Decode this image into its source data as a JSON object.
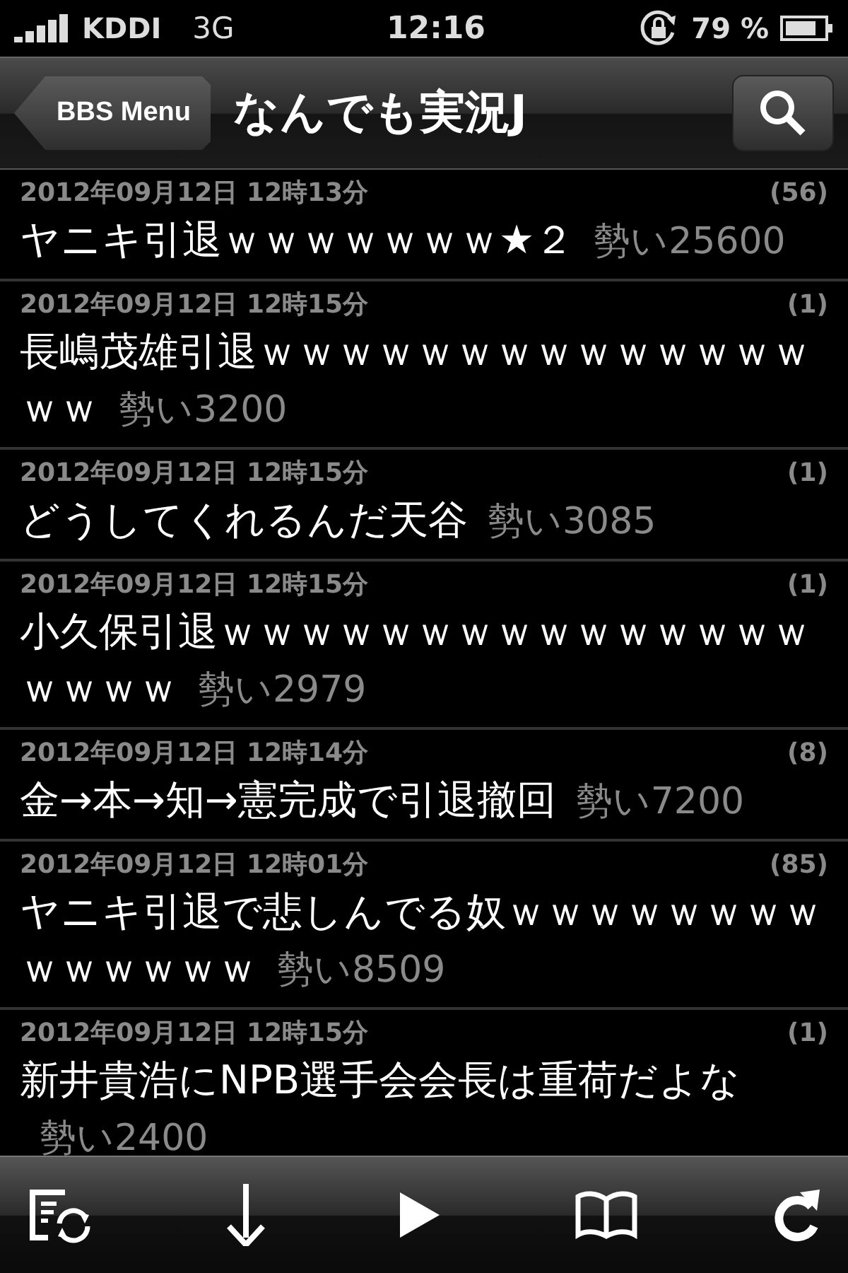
{
  "status_bar": {
    "carrier": "KDDI",
    "network": "3G",
    "time": "12:16",
    "battery": "79 %"
  },
  "nav_bar": {
    "back_button": "BBS Menu",
    "title": "なんでも実況J"
  },
  "threads": [
    {
      "date": "2012年09月12日 12時13分",
      "count": "(56)",
      "title": "ヤニキ引退ｗｗｗｗｗｗｗ★２",
      "momentum": "勢い25600"
    },
    {
      "date": "2012年09月12日 12時15分",
      "count": "(1)",
      "title": "長嶋茂雄引退ｗｗｗｗｗｗｗｗｗｗｗｗｗｗｗｗ",
      "momentum": "勢い3200"
    },
    {
      "date": "2012年09月12日 12時15分",
      "count": "(1)",
      "title": "どうしてくれるんだ天谷",
      "momentum": "勢い3085"
    },
    {
      "date": "2012年09月12日 12時15分",
      "count": "(1)",
      "title": "小久保引退ｗｗｗｗｗｗｗｗｗｗｗｗｗｗｗｗｗｗｗ",
      "momentum": "勢い2979"
    },
    {
      "date": "2012年09月12日 12時14分",
      "count": "(8)",
      "title": "金→本→知→憲完成で引退撤回",
      "momentum": "勢い7200"
    },
    {
      "date": "2012年09月12日 12時01分",
      "count": "(85)",
      "title": "ヤニキ引退で悲しんでる奴ｗｗｗｗｗｗｗｗｗｗｗｗｗｗ",
      "momentum": "勢い8509"
    },
    {
      "date": "2012年09月12日 12時15分",
      "count": "(1)",
      "title": "新井貴浩にNPB選手会会長は重荷だよな",
      "momentum": "勢い2400"
    }
  ]
}
